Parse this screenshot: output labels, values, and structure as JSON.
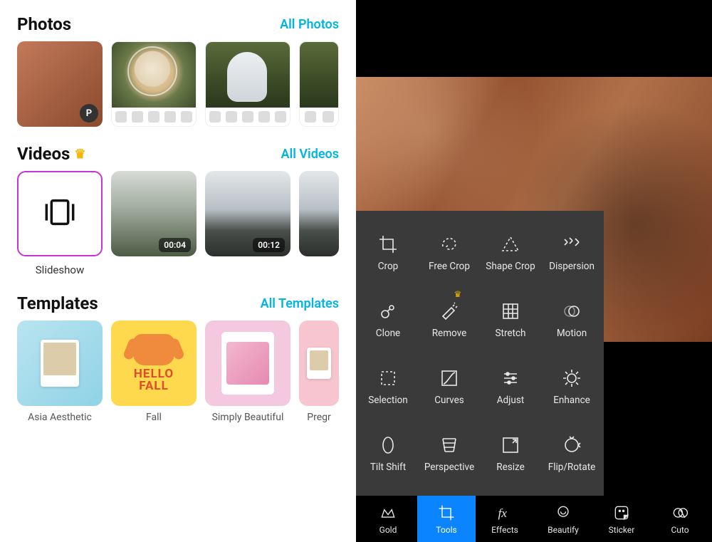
{
  "left": {
    "photos": {
      "title": "Photos",
      "link": "All Photos"
    },
    "videos": {
      "title": "Videos",
      "link": "All Videos",
      "items": [
        {
          "label": "Slideshow",
          "type": "slideshow"
        },
        {
          "duration": "00:04"
        },
        {
          "duration": "00:12"
        }
      ]
    },
    "templates": {
      "title": "Templates",
      "link": "All Templates",
      "items": [
        {
          "label": "Asia Aesthetic"
        },
        {
          "label": "Fall",
          "hello": "HELLO",
          "fall": "FALL"
        },
        {
          "label": "Simply Beautiful"
        },
        {
          "label": "Pregr"
        }
      ]
    }
  },
  "editor": {
    "tools": [
      {
        "id": "crop",
        "label": "Crop"
      },
      {
        "id": "freecrop",
        "label": "Free Crop"
      },
      {
        "id": "shapecrop",
        "label": "Shape Crop"
      },
      {
        "id": "dispersion",
        "label": "Dispersion"
      },
      {
        "id": "clone",
        "label": "Clone"
      },
      {
        "id": "remove",
        "label": "Remove",
        "premium": true
      },
      {
        "id": "stretch",
        "label": "Stretch"
      },
      {
        "id": "motion",
        "label": "Motion"
      },
      {
        "id": "selection",
        "label": "Selection"
      },
      {
        "id": "curves",
        "label": "Curves"
      },
      {
        "id": "adjust",
        "label": "Adjust"
      },
      {
        "id": "enhance",
        "label": "Enhance"
      },
      {
        "id": "tiltshift",
        "label": "Tilt Shift"
      },
      {
        "id": "perspective",
        "label": "Perspective"
      },
      {
        "id": "resize",
        "label": "Resize"
      },
      {
        "id": "fliprotate",
        "label": "Flip/Rotate"
      }
    ],
    "bottom": [
      {
        "id": "gold",
        "label": "Gold"
      },
      {
        "id": "tools",
        "label": "Tools",
        "active": true
      },
      {
        "id": "effects",
        "label": "Effects"
      },
      {
        "id": "beautify",
        "label": "Beautify"
      },
      {
        "id": "sticker",
        "label": "Sticker"
      },
      {
        "id": "cutout",
        "label": "Cuto"
      }
    ]
  }
}
